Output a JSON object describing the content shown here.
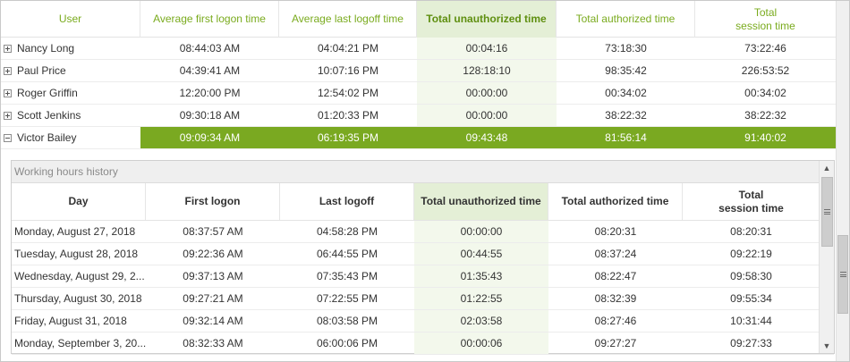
{
  "master": {
    "columns": [
      "User",
      "Average first logon time",
      "Average last logoff time",
      "Total unauthorized time",
      "Total authorized time",
      "Total\nsession time"
    ],
    "rows": [
      {
        "user": "Nancy Long",
        "first": "08:44:03 AM",
        "last": "04:04:21 PM",
        "unauth": "00:04:16",
        "auth": "73:18:30",
        "session": "73:22:46",
        "expanded": false
      },
      {
        "user": "Paul Price",
        "first": "04:39:41 AM",
        "last": "10:07:16 PM",
        "unauth": "128:18:10",
        "auth": "98:35:42",
        "session": "226:53:52",
        "expanded": false
      },
      {
        "user": "Roger Griffin",
        "first": "12:20:00 PM",
        "last": "12:54:02 PM",
        "unauth": "00:00:00",
        "auth": "00:34:02",
        "session": "00:34:02",
        "expanded": false
      },
      {
        "user": "Scott Jenkins",
        "first": "09:30:18 AM",
        "last": "01:20:33 PM",
        "unauth": "00:00:00",
        "auth": "38:22:32",
        "session": "38:22:32",
        "expanded": false
      },
      {
        "user": "Victor Bailey",
        "first": "09:09:34 AM",
        "last": "06:19:35 PM",
        "unauth": "09:43:48",
        "auth": "81:56:14",
        "session": "91:40:02",
        "expanded": true
      }
    ]
  },
  "detail": {
    "caption": "Working hours history",
    "columns": [
      "Day",
      "First logon",
      "Last logoff",
      "Total unauthorized time",
      "Total authorized time",
      "Total\nsession time"
    ],
    "rows": [
      {
        "day": "Monday, August 27, 2018",
        "first": "08:37:57 AM",
        "last": "04:58:28 PM",
        "unauth": "00:00:00",
        "auth": "08:20:31",
        "session": "08:20:31"
      },
      {
        "day": "Tuesday, August 28, 2018",
        "first": "09:22:36 AM",
        "last": "06:44:55 PM",
        "unauth": "00:44:55",
        "auth": "08:37:24",
        "session": "09:22:19"
      },
      {
        "day": "Wednesday, August 29, 2...",
        "first": "09:37:13 AM",
        "last": "07:35:43 PM",
        "unauth": "01:35:43",
        "auth": "08:22:47",
        "session": "09:58:30"
      },
      {
        "day": "Thursday, August 30, 2018",
        "first": "09:27:21 AM",
        "last": "07:22:55 PM",
        "unauth": "01:22:55",
        "auth": "08:32:39",
        "session": "09:55:34"
      },
      {
        "day": "Friday, August 31, 2018",
        "first": "09:32:14 AM",
        "last": "08:03:58 PM",
        "unauth": "02:03:58",
        "auth": "08:27:46",
        "session": "10:31:44"
      },
      {
        "day": "Monday, September 3, 20...",
        "first": "08:32:33 AM",
        "last": "06:00:06 PM",
        "unauth": "00:00:06",
        "auth": "09:27:27",
        "session": "09:27:33"
      }
    ]
  },
  "icons": {
    "expand": "plus-box-icon",
    "collapse": "minus-box-icon",
    "scroll_up": "▲",
    "scroll_down": "▼",
    "grip": "grip-icon"
  },
  "colors": {
    "accent": "#7aa921",
    "header_text": "#7aab1e",
    "sorted_column_bg": "#e4efd6"
  }
}
